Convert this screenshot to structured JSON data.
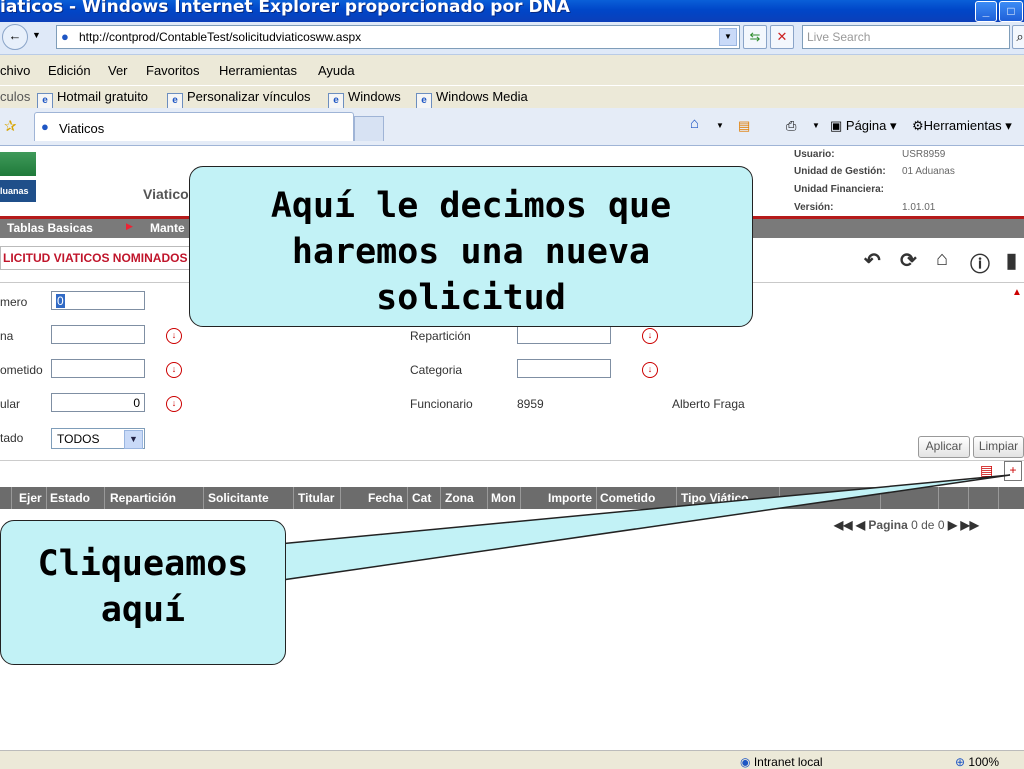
{
  "window": {
    "title": "iaticos - Windows Internet Explorer proporcionado por DNA"
  },
  "address_bar": {
    "url": "http://contprod/ContableTest/solicitudviaticosww.aspx",
    "search_placeholder": "Live Search"
  },
  "menu": [
    "chivo",
    "Edición",
    "Ver",
    "Favoritos",
    "Herramientas",
    "Ayuda"
  ],
  "links_bar": {
    "label": "culos",
    "items": [
      "Hotmail gratuito",
      "Personalizar vínculos",
      "Windows",
      "Windows Media"
    ]
  },
  "tabs": {
    "active": "Viaticos",
    "commands": {
      "page": "Página",
      "tools": "Herramientas"
    }
  },
  "app_header": {
    "logo_text": "luanas",
    "title": "Viatico",
    "usuario_label": "Usuario:",
    "usuario_value": "USR8959",
    "gestion_label": "Unidad de Gestión:",
    "gestion_value": "01 Aduanas",
    "financiera_label": "Unidad Financiera:",
    "version_label": "Versión:",
    "version_value": "1.01.01"
  },
  "nav": {
    "item1": "Tablas Basicas",
    "item2": "Mante"
  },
  "page_title": "LICITUD VIATICOS NOMINADOS",
  "form": {
    "numero_label": "mero",
    "numero_value": "0",
    "zona_label": "na",
    "cometido_label": "ometido",
    "titular_label": "ular",
    "titular_value": "0",
    "estado_label": "tado",
    "estado_value": "TODOS",
    "reparticion_label": "Repartición",
    "categoria_label": "Categoria",
    "funcionario_label": "Funcionario",
    "funcionario_id": "8959",
    "funcionario_name": "Alberto Fraga"
  },
  "buttons": {
    "apply": "Aplicar",
    "clear": "Limpiar"
  },
  "grid": {
    "columns": [
      "Ejer",
      "Estado",
      "Repartición",
      "Solicitante",
      "Titular",
      "Fecha",
      "Cat",
      "Zona",
      "Mon",
      "Importe",
      "Cometido",
      "Tipo Viático"
    ]
  },
  "pager": {
    "label": "Pagina",
    "current": "0",
    "of": "de",
    "total": "0"
  },
  "callouts": {
    "top": "Aquí le decimos que haremos una nueva solicitud",
    "bottom": "Cliqueamos aquí"
  },
  "status": {
    "zone": "Intranet local",
    "zoom": "100%"
  },
  "colors": {
    "title_bar": "#0046c8",
    "nav_bar": "#7a7a7a",
    "accent_red": "#c0152b",
    "callout_fill": "#c2f2f6"
  }
}
